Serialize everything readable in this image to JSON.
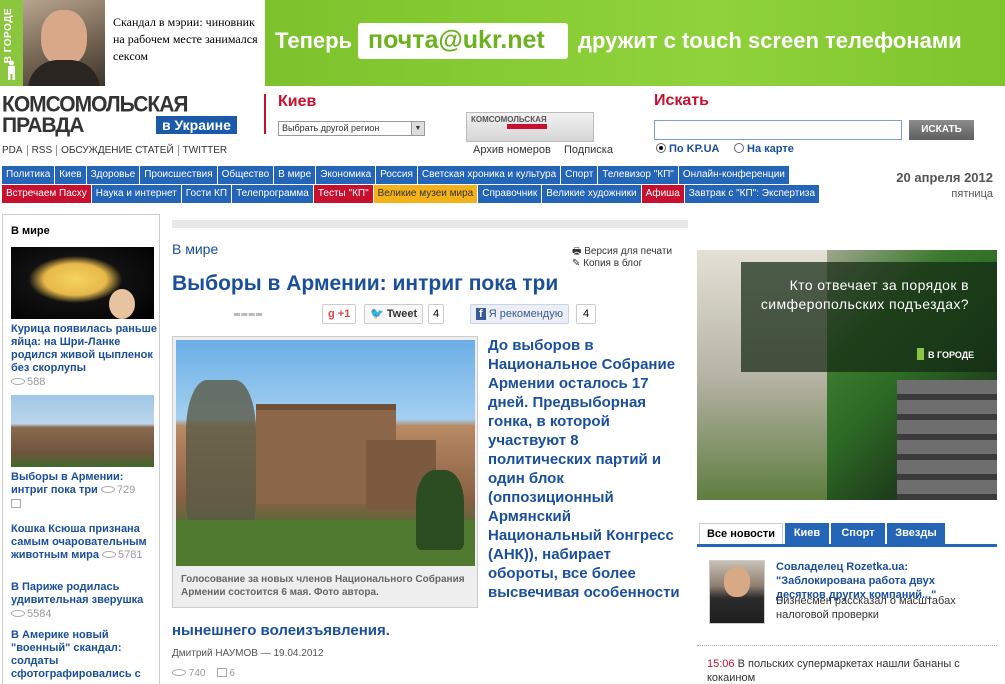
{
  "top": {
    "vgorode_label": "В ГОРОДЕ",
    "news_text": "Скандал в мэрии: чиновник на рабочем месте занимался сексом",
    "banner": {
      "text_before": "Теперь",
      "email": "почта@ukr.net",
      "text_after": "дружит с touch screen телефонами"
    }
  },
  "header": {
    "logo_line1": "КОМСОМОЛЬСКАЯ",
    "logo_line2": "ПРАВДА",
    "logo_badge": "в Украине",
    "city": "Киев",
    "region_select": "Выбрать другой регион",
    "archive_link": "Архив номеров",
    "subscribe_link": "Подписка",
    "search_title": "Искать",
    "search_button": "ИСКАТЬ",
    "search_opt1": "По KP.UA",
    "search_opt2": "На карте",
    "quick_links": [
      "PDA",
      "RSS",
      "ОБСУЖДЕНИЕ СТАТЕЙ",
      "TWITTER"
    ]
  },
  "nav": {
    "row1": [
      "Политика",
      "Киев",
      "Здоровье",
      "Происшествия",
      "Общество",
      "В мире",
      "Экономика",
      "Россия",
      "Светская хроника и культура",
      "Спорт",
      "Телевизор \"КП\"",
      "Онлайн-конференции"
    ],
    "row2": [
      "Встречаем Пасху",
      "Наука и интернет",
      "Гости КП",
      "Телепрограмма",
      "Тесты \"КП\"",
      "Великие музеи мира",
      "Справочник",
      "Великие художники",
      "Афиша",
      "Завтрак с \"КП\": Экспертиза"
    ],
    "date": "20 апреля 2012",
    "weekday": "пятница"
  },
  "left": {
    "heading": "В мире",
    "items": [
      {
        "title": "Курица появилась раньше яйца: на Шри-Ланке родился живой цыпленок без скорлупы",
        "views": "588"
      },
      {
        "title": "Выборы в Армении: интриг пока три",
        "views": "729"
      },
      {
        "title": "Кошка Ксюша признана самым очаровательным животным мира",
        "views": "5781"
      },
      {
        "title": "В Париже родилась удивительная зверушка",
        "views": "5584"
      },
      {
        "title": "В Америке новый \"военный\" скандал: солдаты сфотографировались с частями тел смертников",
        "views": ""
      }
    ]
  },
  "article": {
    "rubric": "В мире",
    "print_link": "Версия для печати",
    "blog_link": "Копия в блог",
    "headline": "Выборы в Армении: интриг пока три",
    "gplus": "+1",
    "tweet": "Tweet",
    "tweet_count": "4",
    "fb": "Я рекомендую",
    "fb_count": "4",
    "caption": "Голосование за новых членов Национального Собрания Армении состоится 6 мая. Фото автора.",
    "lead": "До выборов в Национальное Собрание Армении осталось 17 дней. Предвыборная гонка, в которой участвуют 8 политических партий и один блок (оппозиционный Армянский Национальный Конгресс (АНК)), набирает обороты, все более высвечивая особенности",
    "lead_tail": "нынешнего волеизъявления.",
    "byline": "Дмитрий НАУМОВ — 19.04.2012",
    "views": "740",
    "comments": "6"
  },
  "right": {
    "ad_question": "Кто отвечает за порядок в симферопольских подъездах?",
    "ad_brand": "В ГОРОДЕ",
    "tabs": [
      "Все новости",
      "Киев",
      "Спорт",
      "Звезды"
    ],
    "featured_title": "Совладелец Rozetka.ua: \"Заблокирована работа двух десятков других компаний...\"",
    "featured_text": "Бизнесмен рассказал о масштабах налоговой проверки",
    "item_time": "15:06",
    "item_text": "В польских супермаркетах нашли бананы с кокаином"
  }
}
